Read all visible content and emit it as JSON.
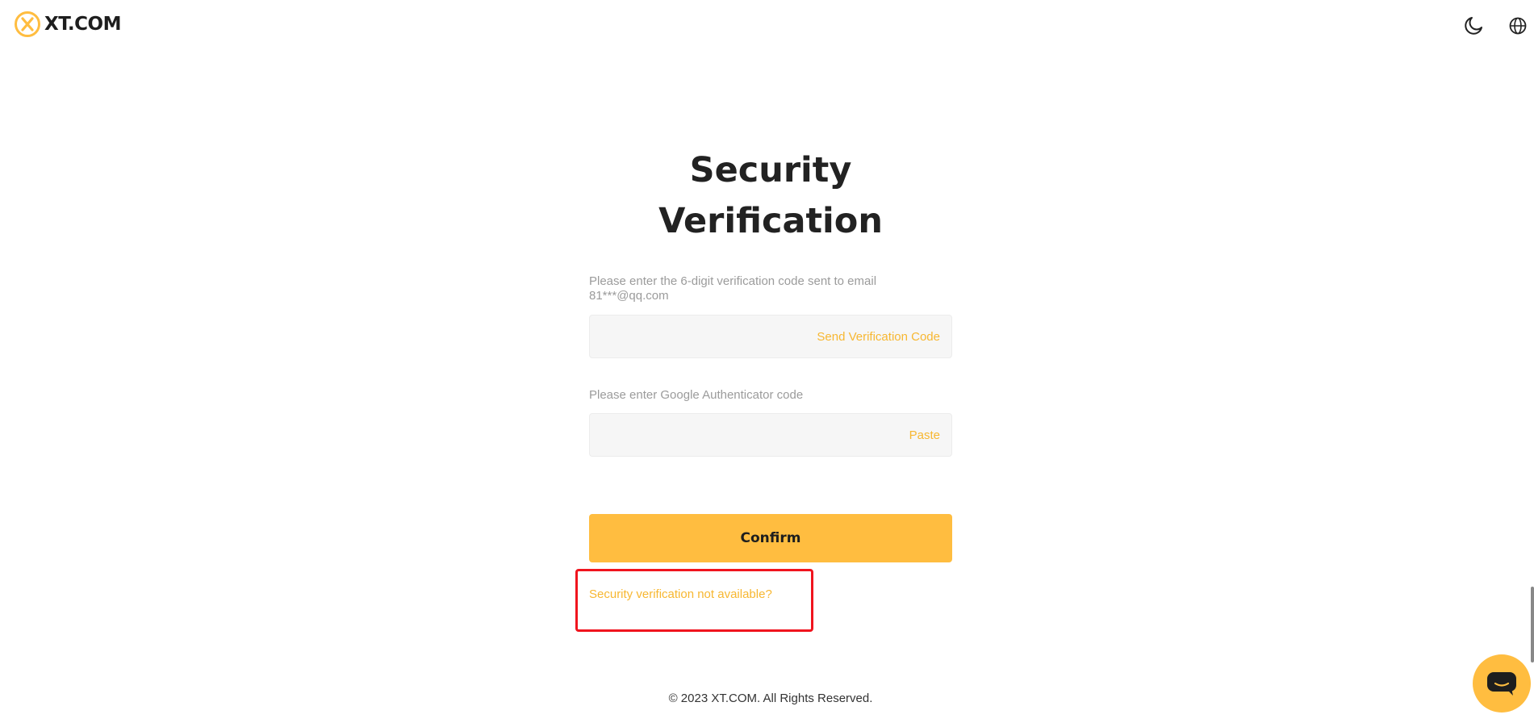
{
  "header": {
    "logo_text": "XT.COM",
    "theme_icon": "moon-icon",
    "language_icon": "globe-icon"
  },
  "form": {
    "title_line1": "Security",
    "title_line2": "Verification",
    "email_label": "Please enter the 6-digit verification code sent to email 81***@qq.com",
    "email_code_value": "",
    "send_code_label": "Send Verification Code",
    "ga_label": "Please enter Google Authenticator code",
    "ga_code_value": "",
    "paste_label": "Paste",
    "confirm_label": "Confirm",
    "unavailable_link": "Security verification not available?"
  },
  "footer": {
    "copyright": "© 2023 XT.COM. All Rights Reserved."
  },
  "colors": {
    "brand": "#ffbd40",
    "link": "#f7b731",
    "highlight": "#f0141e"
  }
}
